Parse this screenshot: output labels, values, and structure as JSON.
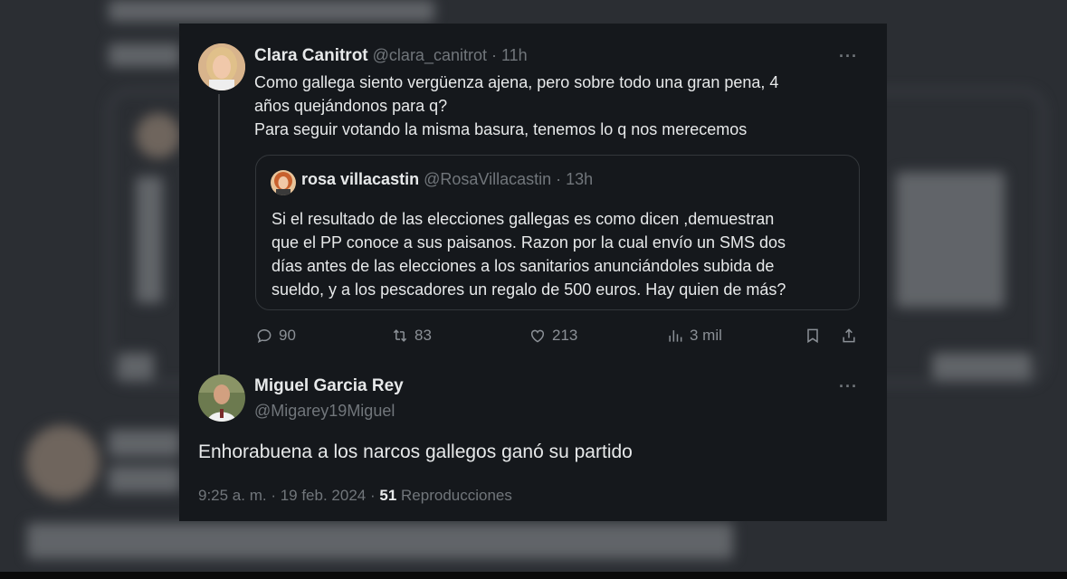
{
  "colors": {
    "panel_bg": "#15181c",
    "text": "#e7e9ea",
    "muted": "#71767b",
    "border": "#33373b"
  },
  "tweet1": {
    "name": "Clara Canitrot",
    "handle": "@clara_canitrot",
    "time": "· 11h",
    "lines": [
      "Como gallega siento vergüenza ajena, pero sobre todo una gran pena, 4",
      "años quejándonos para q?",
      "Para seguir votando la misma basura, tenemos lo q nos merecemos"
    ],
    "more": "···"
  },
  "quote": {
    "name": "rosa villacastin",
    "handle": "@RosaVillacastin",
    "time": "· 13h",
    "lines": [
      "Si el resultado de las elecciones gallegas es como dicen ,demuestran",
      "que el PP conoce a sus paisanos. Razon por la cual envío un SMS dos",
      "días antes de las elecciones a los sanitarios anunciándoles subida de",
      "sueldo, y a los pescadores un regalo de 500 euros. Hay quien de más?"
    ]
  },
  "actions": {
    "replies": "90",
    "reposts": "83",
    "likes": "213",
    "views": "3 mil",
    "icons": [
      "reply-icon",
      "repost-icon",
      "like-icon",
      "views-icon",
      "bookmark-icon",
      "share-icon"
    ]
  },
  "tweet2": {
    "name": "Miguel Garcia Rey",
    "handle": "@Migarey19Miguel",
    "text": "Enhorabuena a los narcos gallegos ganó su partido",
    "timestamp": "9:25 a. m. · 19 feb. 2024 ·",
    "views_count": "51",
    "views_label": "Reproducciones",
    "more": "···"
  }
}
